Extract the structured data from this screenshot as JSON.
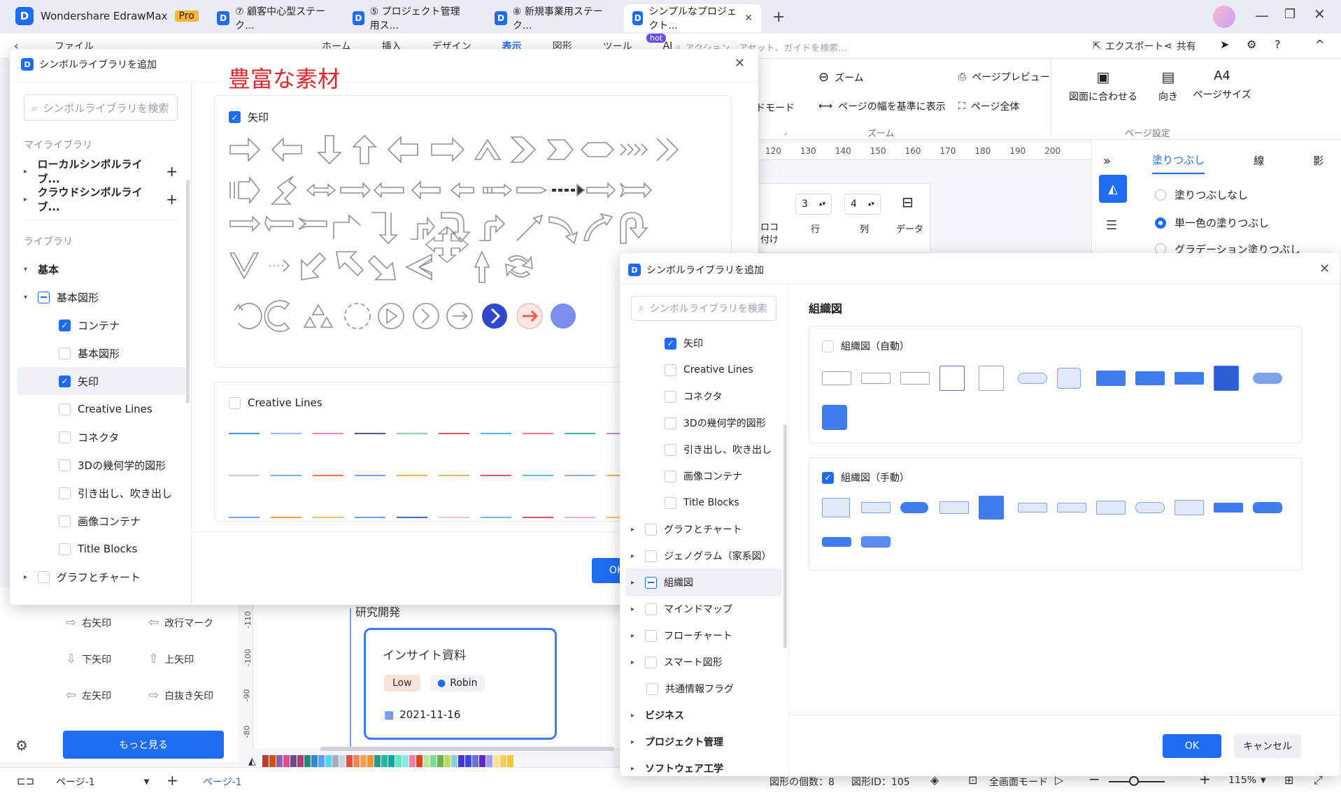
{
  "app": {
    "name": "Wondershare EdrawMax",
    "badge": "Pro"
  },
  "tabs": [
    {
      "label": "⑦ 顧客中心型ステーク..."
    },
    {
      "label": "⑤ プロジェクト管理用ス..."
    },
    {
      "label": "⑧ 新規事業用ステーク..."
    },
    {
      "label": "シンプルなプロジェクト..."
    }
  ],
  "menubar": {
    "file": "ファイル",
    "items": [
      "ホーム",
      "挿入",
      "デザイン",
      "表示",
      "図形",
      "ツール",
      "AI"
    ],
    "ai_badge": "hot",
    "search_placeholder": "アクション、アセット、ガイドを検索...",
    "export": "エクスポート",
    "share": "共有"
  },
  "ribbon": {
    "mode_label": "ドモード",
    "zoom": "ズーム",
    "fit_width": "ページの幅を基準に表示",
    "zoom_group": "ズーム",
    "page_preview": "ページプレビュー",
    "whole_page": "ページ全体",
    "fit_to_drawing": "図面に合わせる",
    "orientation": "向き",
    "page_size": "ページサイズ",
    "page_setup_group": "ページ設定"
  },
  "ruler": {
    "ticks": [
      "120",
      "130",
      "140",
      "150",
      "160",
      "170",
      "180",
      "190",
      "200"
    ]
  },
  "table_props": {
    "rows_value": "3",
    "rows_label": "行",
    "cols_value": "4",
    "cols_label": "列",
    "data_label": "データ",
    "left_top": "ロコ",
    "left_bottom": "付け"
  },
  "right_panel": {
    "tabs": [
      "塗りつぶし",
      "線",
      "影"
    ],
    "options": [
      "塗りつぶしなし",
      "単一色の塗りつぶし",
      "グラデーション塗りつぶし"
    ]
  },
  "annotation": "豊富な素材",
  "dialog1": {
    "title": "シンボルライブラリを追加",
    "search_placeholder": "シンボルライブラリを検索",
    "my_library": "マイライブラリ",
    "local": "ローカルシンボルライブ...",
    "cloud": "クラウドシンボルライブ...",
    "library": "ライブラリ",
    "basic": "基本",
    "basic_shapes_group": "基本図形",
    "items": [
      "コンテナ",
      "基本図形",
      "矢印",
      "Creative Lines",
      "コネクタ",
      "3Dの幾何学的図形",
      "引き出し、吹き出し",
      "画像コンテナ",
      "Title Blocks"
    ],
    "charts": "グラフとチャート",
    "section_arrows": "矢印",
    "section_lines": "Creative Lines",
    "ok": "OK"
  },
  "dialog2": {
    "title": "シンボルライブラリを追加",
    "search_placeholder": "シンボルライブラリを検索",
    "items": [
      "矢印",
      "Creative Lines",
      "コネクタ",
      "3Dの幾何学的図形",
      "引き出し、吹き出し",
      "画像コンテナ",
      "Title Blocks"
    ],
    "groups": [
      "グラフとチャート",
      "ジェノグラム（家系図）",
      "組織図",
      "マインドマップ",
      "フローチャート",
      "スマート図形",
      "共通情報フラグ"
    ],
    "categories": [
      "ビジネス",
      "プロジェクト管理",
      "ソフトウェア工学"
    ],
    "heading": "組織図",
    "section_auto": "組織図（自動）",
    "section_manual": "組織図（手動）",
    "ok": "OK",
    "cancel": "キャンセル"
  },
  "left_panel": {
    "arrows": [
      "右矢印",
      "改行マーク",
      "下矢印",
      "上矢印",
      "左矢印",
      "白抜き矢印"
    ],
    "more": "もっと見る"
  },
  "vruler": [
    "-110",
    "-100",
    "-90",
    "-80"
  ],
  "canvas": {
    "heading": "研究開発",
    "card_title": "インサイト資料",
    "priority": "Low",
    "assignee": "Robin",
    "date": "2021-11-16"
  },
  "statusbar": {
    "page_selector": "ページ-1",
    "page_tab": "ページ-1",
    "shape_count": "図形の個数：8",
    "shape_id": "図形ID：105",
    "fullscreen": "全画面モード",
    "zoom": "115%"
  },
  "colors": {
    "accent": "#1d6cf2",
    "annotation": "#e0262a"
  }
}
